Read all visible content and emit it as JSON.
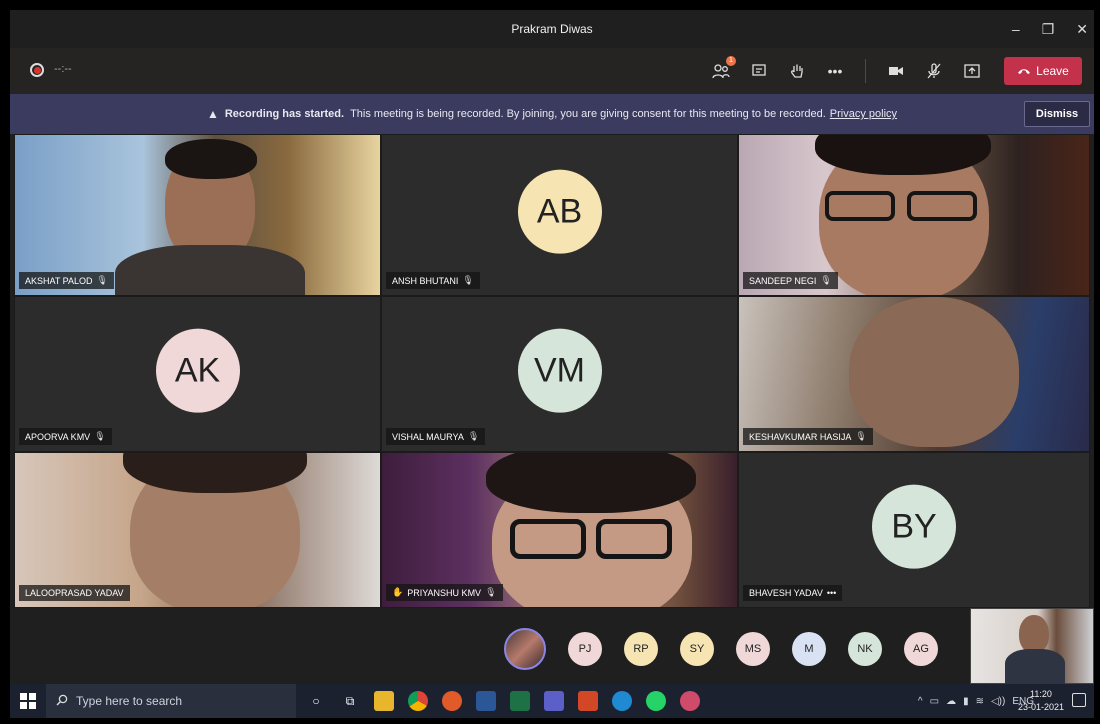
{
  "window": {
    "title": "Prakram Diwas",
    "controls": [
      "–",
      "❐",
      "✕"
    ]
  },
  "toolbar": {
    "recording_time": "--:--",
    "people_badge": "1",
    "leave_label": "Leave",
    "icons": [
      "participants-icon",
      "chat-icon",
      "raise-hand-icon",
      "more-actions-icon",
      "camera-icon",
      "mic-off-icon",
      "share-tray-icon"
    ]
  },
  "banner": {
    "bold": "Recording has started.",
    "text": "This meeting is being recorded. By joining, you are giving consent for this meeting to be recorded.",
    "link": "Privacy policy",
    "dismiss_label": "Dismiss"
  },
  "tiles": [
    {
      "name": "AKSHAT PALOD",
      "type": "video"
    },
    {
      "name": "ANSH BHUTANI",
      "type": "avatar",
      "initials": "AB",
      "color": "#f6e4b3"
    },
    {
      "name": "SANDEEP NEGI",
      "type": "video"
    },
    {
      "name": "APOORVA KMV",
      "type": "avatar",
      "initials": "AK",
      "color": "#f0d8d8"
    },
    {
      "name": "VISHAL MAURYA",
      "type": "avatar",
      "initials": "VM",
      "color": "#d6e5da"
    },
    {
      "name": "KESHAVKUMAR HASIJA",
      "type": "video"
    },
    {
      "name": "LALOOPRASAD YADAV",
      "type": "video"
    },
    {
      "name": "PRIYANSHU KMV",
      "type": "video",
      "hand_raised": true
    },
    {
      "name": "BHAVESH YADAV",
      "type": "avatar",
      "initials": "BY",
      "color": "#d6e5da",
      "more": "•••"
    }
  ],
  "participants_row": [
    {
      "initials": "PJ",
      "color": "#f0d8d8"
    },
    {
      "initials": "RP",
      "color": "#f6e4b3"
    },
    {
      "initials": "SY",
      "color": "#f6e4b3"
    },
    {
      "initials": "MS",
      "color": "#f0d8d8"
    },
    {
      "initials": "M",
      "color": "#d9e2f2"
    },
    {
      "initials": "NK",
      "color": "#d6e5da"
    },
    {
      "initials": "AG",
      "color": "#f0d8d8"
    }
  ],
  "taskbar": {
    "search_placeholder": "Type here to search",
    "language": "ENG",
    "time": "11:20",
    "date": "23-01-2021"
  },
  "colors": {
    "leave": "#c4314b",
    "banner": "#3a3b5e",
    "accent": "#8a86e8"
  }
}
